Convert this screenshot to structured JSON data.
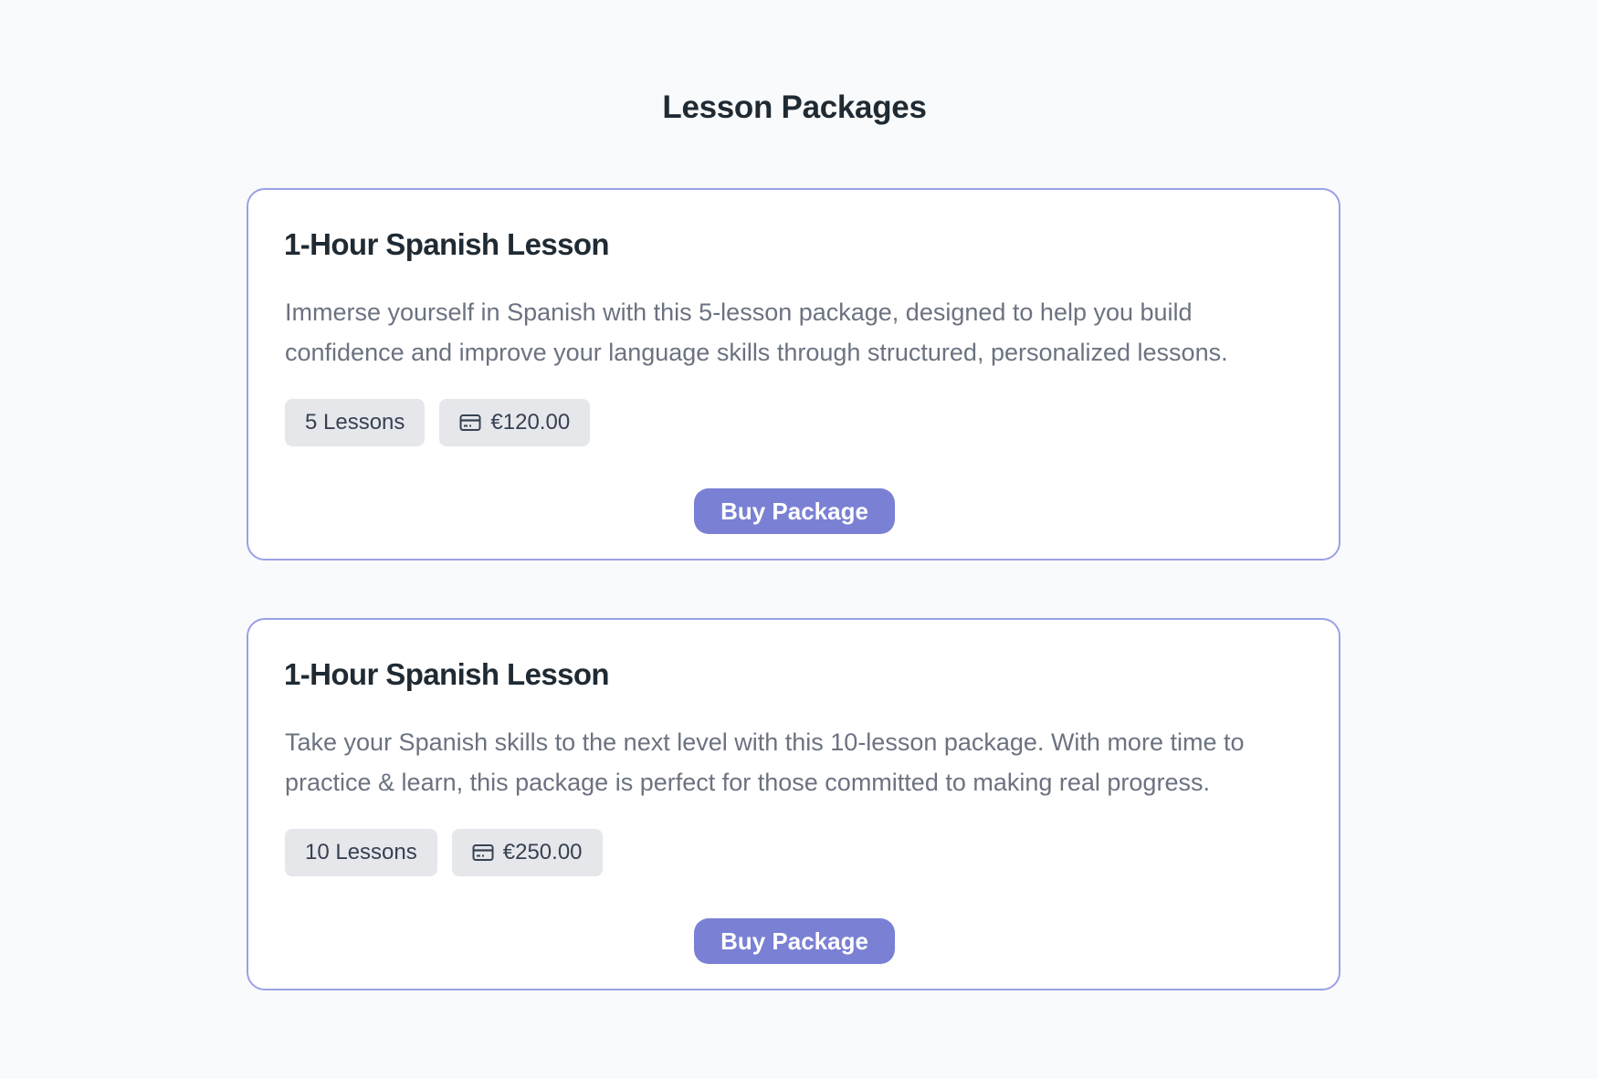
{
  "page": {
    "title": "Lesson Packages"
  },
  "packages": [
    {
      "title": "1-Hour Spanish Lesson",
      "description": "Immerse yourself in Spanish with this 5-lesson package, designed to help you build confidence and improve your language skills through structured, personalized lessons.",
      "lessons_label": "5 Lessons",
      "price_label": "€120.00",
      "price_icon": "credit-card-icon",
      "button_label": "Buy Package"
    },
    {
      "title": "1-Hour Spanish Lesson",
      "description": "Take your Spanish skills to the next level with this 10-lesson package. With more time to practice & learn, this package is perfect for those committed to making real progress.",
      "lessons_label": "10 Lessons",
      "price_label": "€250.00",
      "price_icon": "credit-card-icon",
      "button_label": "Buy Package"
    }
  ],
  "colors": {
    "background": "#f9fafb",
    "card_border": "#9aa1e6",
    "accent": "#7a80d4",
    "tag_background": "#e5e7eb",
    "text_dark": "#1f2a33",
    "text_muted": "#6b7280"
  }
}
